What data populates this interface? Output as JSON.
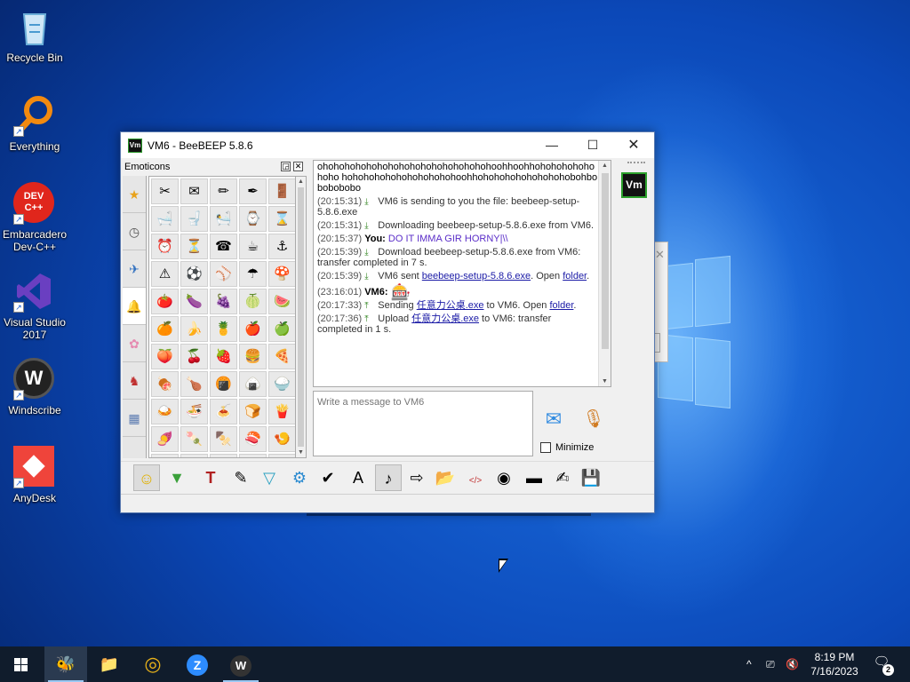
{
  "desktop": {
    "icons": [
      {
        "label": "Recycle Bin",
        "icon": "recycle-bin-icon",
        "color": "#7cc4f2"
      },
      {
        "label": "Everything",
        "icon": "everything-search-icon",
        "color": "#f28a10"
      },
      {
        "label": "Embarcadero Dev-C++",
        "icon": "devcpp-icon",
        "color": "#e0261c"
      },
      {
        "label": "Visual Studio 2017",
        "icon": "visual-studio-icon",
        "color": "#6a3fc1"
      },
      {
        "label": "Windscribe",
        "icon": "windscribe-icon",
        "color": "#222222"
      },
      {
        "label": "AnyDesk",
        "icon": "anydesk-icon",
        "color": "#ef443b"
      }
    ],
    "devcpp_badge": "DEV C++"
  },
  "window": {
    "title": "VM6 - BeeBEEP 5.8.6",
    "app_icon_text": "Vm",
    "accent": "#2ba02b",
    "controls": {
      "minimize": "—",
      "maximize": "☐",
      "close": "✕"
    }
  },
  "emoticons": {
    "header": "Emoticons",
    "tabs": [
      "★",
      "◷",
      "✈",
      "🔔",
      "✿",
      "♞",
      "▦"
    ],
    "cells": [
      "✂",
      "✉",
      "✏",
      "✒",
      "🚪",
      "🛁",
      "🚽",
      "🛀",
      "⌚",
      "⌛",
      "⏰",
      "⏳",
      "☎",
      "☕",
      "⚓",
      "⚠",
      "⚽",
      "⚾",
      "☂",
      "🍄",
      "🍅",
      "🍆",
      "🍇",
      "🍈",
      "🍉",
      "🍊",
      "🍌",
      "🍍",
      "🍎",
      "🍏",
      "🍑",
      "🍒",
      "🍓",
      "🍔",
      "🍕",
      "🍖",
      "🍗",
      "🍘",
      "🍙",
      "🍚",
      "🍛",
      "🍜",
      "🍝",
      "🍞",
      "🍟",
      "🍠",
      "🍡",
      "🍢",
      "🍣",
      "🍤",
      "🍥",
      "🍦",
      "🍧",
      "🍨",
      "🍩"
    ]
  },
  "chat": {
    "overflow_text": "ohohohohohohohohohohohohohohohohoohhoohhohohohohohohoho hohohohohohohohohohohoohhohohohohohohohohobohbobobobobo",
    "messages": [
      {
        "ts": "(20:15:31)",
        "text": " VM6 is sending to you the file: beebeep-setup-5.8.6.exe"
      },
      {
        "ts": "(20:15:31)",
        "text": " Downloading beebeep-setup-5.8.6.exe from VM6."
      },
      {
        "ts": "(20:15:37)",
        "sender": "You:",
        "text": " DO IT IMMA GIR HORNY|\\\\"
      },
      {
        "ts": "(20:15:39)",
        "text": " Download beebeep-setup-5.8.6.exe from VM6: transfer completed in 7 s."
      },
      {
        "ts": "(20:15:39)",
        "text_pre": " VM6 sent ",
        "link": "beebeep-setup-5.8.6.exe",
        "text_mid": ". Open ",
        "link2": "folder",
        "text_post": "."
      },
      {
        "ts": "(23:16:01)",
        "sender": "VM6:",
        "emoji": "🎰"
      },
      {
        "ts": "(20:17:33)",
        "text_pre": " Sending ",
        "link": "任意力公桌.exe",
        "text_mid": " to VM6. Open ",
        "link2": "folder",
        "text_post": "."
      },
      {
        "ts": "(20:17:36)",
        "text_pre": " Upload ",
        "link": "任意力公桌.exe",
        "text_mid": " to VM6: transfer completed in 1 s."
      }
    ]
  },
  "input": {
    "placeholder": "Write a message to VM6"
  },
  "minimize_label": "Minimize",
  "side": {
    "avatar_text": "Vm"
  },
  "toolbar": {
    "buttons": [
      {
        "name": "emoticons-button",
        "glyph": "☺"
      },
      {
        "name": "hide-bar-button",
        "glyph": "▼"
      },
      {
        "name": "font-button",
        "glyph": "T"
      },
      {
        "name": "color-button",
        "glyph": "✎"
      },
      {
        "name": "filter-button",
        "glyph": "▽"
      },
      {
        "name": "settings-button",
        "glyph": "⚙"
      },
      {
        "name": "spellcheck-button",
        "glyph": "✔"
      },
      {
        "name": "text-button",
        "glyph": "A"
      },
      {
        "name": "music-button",
        "glyph": "♪"
      },
      {
        "name": "send-file-button",
        "glyph": "⇨"
      },
      {
        "name": "send-folder-button",
        "glyph": "📂"
      },
      {
        "name": "code-button",
        "glyph": "</>"
      },
      {
        "name": "screenshot-button",
        "glyph": "◉"
      },
      {
        "name": "window-button",
        "glyph": "▬"
      },
      {
        "name": "notes-button",
        "glyph": "✍"
      },
      {
        "name": "save-button",
        "glyph": "💾"
      }
    ]
  },
  "taskbar": {
    "apps": [
      {
        "name": "beebeep",
        "glyph": "🐝"
      },
      {
        "name": "file-explorer",
        "glyph": "📁"
      },
      {
        "name": "chrome",
        "glyph": "◎"
      },
      {
        "name": "zoom",
        "glyph": "Z"
      },
      {
        "name": "windscribe",
        "glyph": "W"
      }
    ],
    "tray": {
      "chevron": "^",
      "network": "⎚",
      "volume": "🔇"
    },
    "time": "8:19 PM",
    "date": "7/16/2023",
    "notifications": "2"
  }
}
